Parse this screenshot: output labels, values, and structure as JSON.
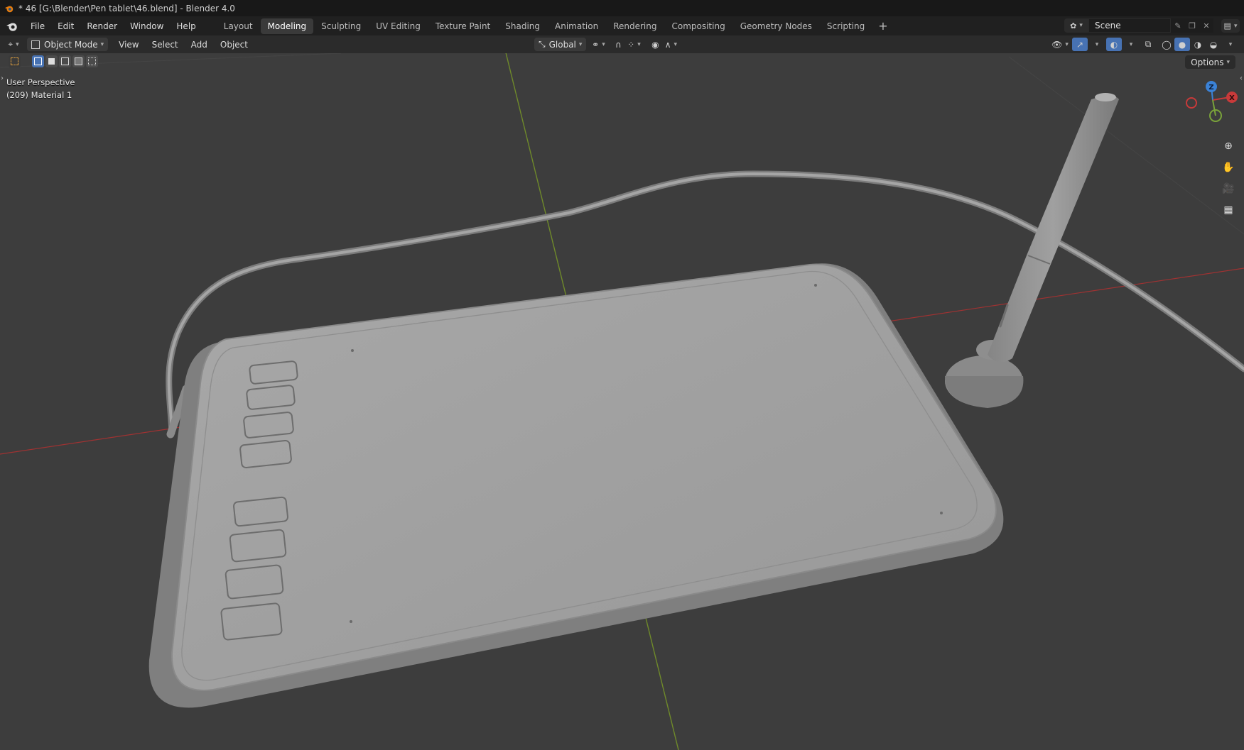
{
  "window": {
    "title": "* 46 [G:\\Blender\\Pen tablet\\46.blend] - Blender 4.0"
  },
  "menu": {
    "items": [
      "File",
      "Edit",
      "Render",
      "Window",
      "Help"
    ]
  },
  "workspaces": {
    "tabs": [
      "Layout",
      "Modeling",
      "Sculpting",
      "UV Editing",
      "Texture Paint",
      "Shading",
      "Animation",
      "Rendering",
      "Compositing",
      "Geometry Nodes",
      "Scripting"
    ],
    "active": "Modeling",
    "add_label": "+"
  },
  "scene": {
    "name": "Scene"
  },
  "header": {
    "mode": "Object Mode",
    "menus": [
      "View",
      "Select",
      "Add",
      "Object"
    ],
    "orientation": "Global",
    "options_label": "Options"
  },
  "viewport": {
    "perspective": "User Perspective",
    "object_info": "(209) Material 1",
    "axes": {
      "x": "X",
      "y": "Y",
      "z": "Z"
    }
  },
  "colors": {
    "accent": "#4772b3",
    "x_axis": "#c83a3a",
    "y_axis": "#7aa33a",
    "z_axis": "#3b82d6"
  },
  "icons": [
    "blender-logo-icon",
    "editor-type-icon",
    "transform-pivot-icon",
    "snap-icon",
    "proportional-edit-icon",
    "visibility-icon",
    "gizmo-icon",
    "overlay-icon",
    "xray-icon",
    "wireframe-shading-icon",
    "solid-shading-icon",
    "material-shading-icon",
    "rendered-shading-icon",
    "zoom-icon",
    "hand-pan-icon",
    "camera-view-icon",
    "ortho-grid-icon"
  ]
}
